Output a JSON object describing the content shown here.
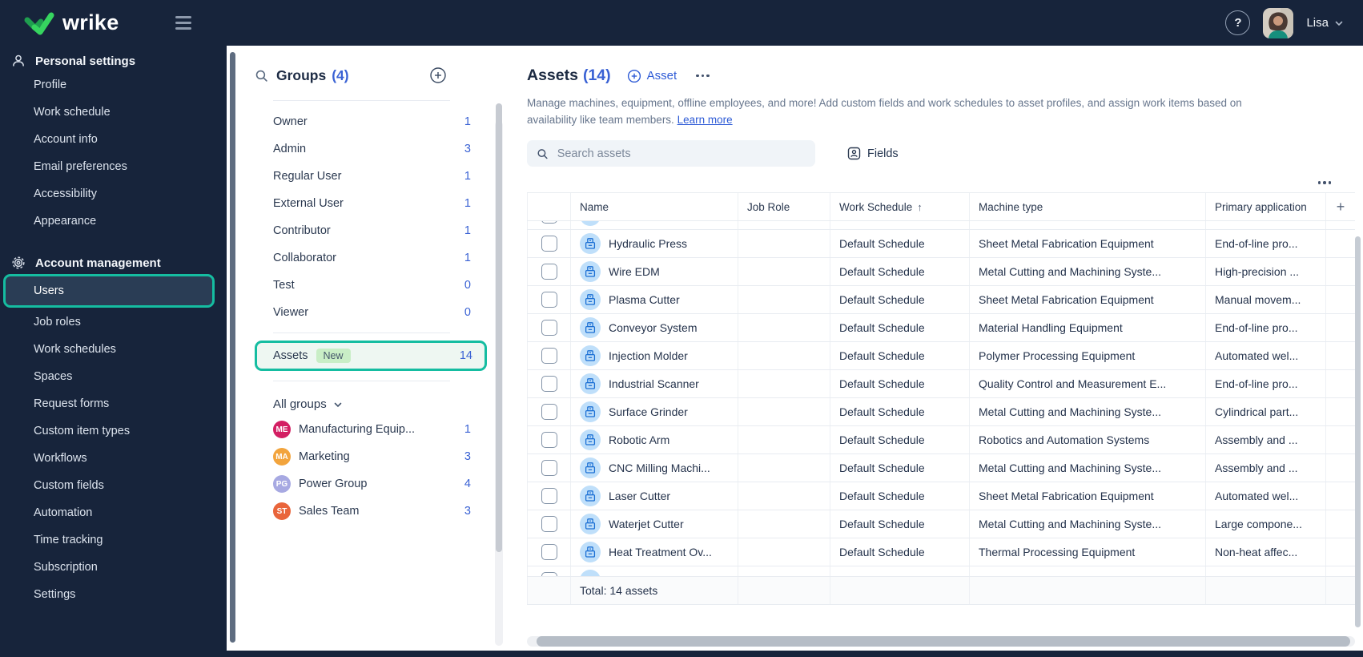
{
  "topbar": {
    "logo_text": "wrike",
    "help_glyph": "?",
    "user_name": "Lisa"
  },
  "sidebar": {
    "sections": [
      {
        "title": "Personal settings",
        "items": [
          {
            "label": "Profile"
          },
          {
            "label": "Work schedule"
          },
          {
            "label": "Account info"
          },
          {
            "label": "Email preferences"
          },
          {
            "label": "Accessibility"
          },
          {
            "label": "Appearance"
          }
        ]
      },
      {
        "title": "Account management",
        "items": [
          {
            "label": "Users",
            "cls": "active"
          },
          {
            "label": "Job roles"
          },
          {
            "label": "Work schedules"
          },
          {
            "label": "Spaces"
          },
          {
            "label": "Request forms"
          },
          {
            "label": "Custom item types"
          },
          {
            "label": "Workflows"
          },
          {
            "label": "Custom fields"
          },
          {
            "label": "Automation"
          },
          {
            "label": "Time tracking"
          },
          {
            "label": "Subscription"
          },
          {
            "label": "Settings"
          }
        ]
      }
    ]
  },
  "groups_panel": {
    "title": "Groups",
    "count": "(4)",
    "roles": [
      {
        "name": "Owner",
        "count": "1"
      },
      {
        "name": "Admin",
        "count": "3"
      },
      {
        "name": "Regular User",
        "count": "1"
      },
      {
        "name": "External User",
        "count": "1"
      },
      {
        "name": "Contributor",
        "count": "1"
      },
      {
        "name": "Collaborator",
        "count": "1"
      },
      {
        "name": "Test",
        "count": "0"
      },
      {
        "name": "Viewer",
        "count": "0"
      }
    ],
    "assets_item": {
      "name": "Assets",
      "badge": "New",
      "count": "14"
    },
    "filter_label": "All groups",
    "teams": [
      {
        "initials": "ME",
        "name": "Manufacturing Equip...",
        "count": "1",
        "color": "#d31f63"
      },
      {
        "initials": "MA",
        "name": "Marketing",
        "count": "3",
        "color": "#f2a43d"
      },
      {
        "initials": "PG",
        "name": "Power Group",
        "count": "4",
        "color": "#a7a9e2"
      },
      {
        "initials": "ST",
        "name": "Sales Team",
        "count": "3",
        "color": "#e9653b"
      }
    ]
  },
  "main": {
    "title": "Assets",
    "count": "(14)",
    "add_button": "Asset",
    "description_line1": "Manage machines, equipment, offline employees, and more! Add custom fields and work schedules to asset profiles, and assign work items based on",
    "description_line2": "availability like team members.",
    "learn_more": "Learn more",
    "search_placeholder": "Search assets",
    "fields_button": "Fields",
    "table": {
      "columns": {
        "name": "Name",
        "job_role": "Job Role",
        "work_schedule": "Work Schedule",
        "machine_type": "Machine type",
        "primary_application": "Primary application"
      },
      "sort": {
        "column": "Work Schedule",
        "direction": "asc",
        "arrow": "↑"
      },
      "add_column_glyph": "+",
      "rows": [
        {
          "name": "Hydraulic Press",
          "job_role": "",
          "schedule": "Default Schedule",
          "machine_type": "Sheet Metal Fabrication Equipment",
          "primary_app": "End-of-line pro..."
        },
        {
          "name": "Wire EDM",
          "job_role": "",
          "schedule": "Default Schedule",
          "machine_type": "Metal Cutting and Machining Syste...",
          "primary_app": "High-precision ..."
        },
        {
          "name": "Plasma Cutter",
          "job_role": "",
          "schedule": "Default Schedule",
          "machine_type": "Sheet Metal Fabrication Equipment",
          "primary_app": "Manual movem..."
        },
        {
          "name": "Conveyor System",
          "job_role": "",
          "schedule": "Default Schedule",
          "machine_type": "Material Handling Equipment",
          "primary_app": "End-of-line pro..."
        },
        {
          "name": "Injection Molder",
          "job_role": "",
          "schedule": "Default Schedule",
          "machine_type": "Polymer Processing Equipment",
          "primary_app": "Automated wel..."
        },
        {
          "name": "Industrial Scanner",
          "job_role": "",
          "schedule": "Default Schedule",
          "machine_type": "Quality Control and Measurement E...",
          "primary_app": "End-of-line pro..."
        },
        {
          "name": "Surface Grinder",
          "job_role": "",
          "schedule": "Default Schedule",
          "machine_type": "Metal Cutting and Machining Syste...",
          "primary_app": "Cylindrical part..."
        },
        {
          "name": "Robotic Arm",
          "job_role": "",
          "schedule": "Default Schedule",
          "machine_type": "Robotics and Automation Systems",
          "primary_app": "Assembly and ..."
        },
        {
          "name": "CNC Milling Machi...",
          "job_role": "",
          "schedule": "Default Schedule",
          "machine_type": "Metal Cutting and Machining Syste...",
          "primary_app": "Assembly and ..."
        },
        {
          "name": "Laser Cutter",
          "job_role": "",
          "schedule": "Default Schedule",
          "machine_type": "Sheet Metal Fabrication Equipment",
          "primary_app": "Automated wel..."
        },
        {
          "name": "Waterjet Cutter",
          "job_role": "",
          "schedule": "Default Schedule",
          "machine_type": "Metal Cutting and Machining Syste...",
          "primary_app": "Large compone..."
        },
        {
          "name": "Heat Treatment Ov...",
          "job_role": "",
          "schedule": "Default Schedule",
          "machine_type": "Thermal Processing Equipment",
          "primary_app": "Non-heat affec..."
        }
      ],
      "total": "Total: 14 assets"
    }
  },
  "colors": {
    "topbar_bg": "#17243b",
    "accent_teal": "#15bda1",
    "link_blue": "#2e5bd6",
    "count_blue": "#3a62d4",
    "badge_green_bg": "#c9eec6",
    "asset_icon_bg": "#bfdffa"
  }
}
